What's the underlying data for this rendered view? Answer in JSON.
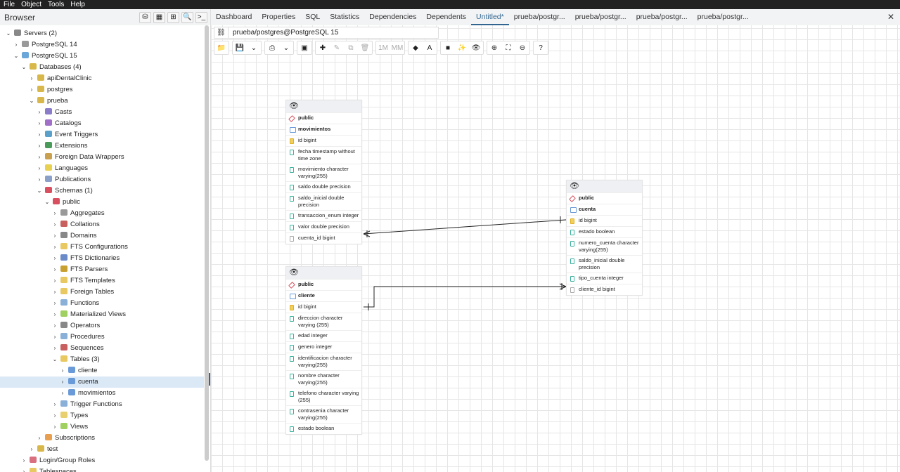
{
  "menu": [
    "File",
    "Object",
    "Tools",
    "Help"
  ],
  "browser": {
    "title": "Browser",
    "tools": [
      "⛁",
      "▦",
      "⊞",
      "🔍",
      ">_"
    ]
  },
  "tree": [
    {
      "label": "Servers (2)",
      "level": 0,
      "open": true,
      "color": "#888"
    },
    {
      "label": "PostgreSQL 14",
      "level": 1,
      "open": false,
      "color": "#999"
    },
    {
      "label": "PostgreSQL 15",
      "level": 1,
      "open": true,
      "color": "#6aa7d8"
    },
    {
      "label": "Databases (4)",
      "level": 2,
      "open": true,
      "color": "#d8b84a"
    },
    {
      "label": "apiDentalClinic",
      "level": 3,
      "open": false,
      "color": "#d8b84a"
    },
    {
      "label": "postgres",
      "level": 3,
      "open": false,
      "color": "#d8b84a"
    },
    {
      "label": "prueba",
      "level": 3,
      "open": true,
      "color": "#d8b84a"
    },
    {
      "label": "Casts",
      "level": 4,
      "open": false,
      "color": "#8a7cc8"
    },
    {
      "label": "Catalogs",
      "level": 4,
      "open": false,
      "color": "#a070c8"
    },
    {
      "label": "Event Triggers",
      "level": 4,
      "open": false,
      "color": "#5aa0c8"
    },
    {
      "label": "Extensions",
      "level": 4,
      "open": false,
      "color": "#4a9a5a"
    },
    {
      "label": "Foreign Data Wrappers",
      "level": 4,
      "open": false,
      "color": "#c8a050"
    },
    {
      "label": "Languages",
      "level": 4,
      "open": false,
      "color": "#e8d050"
    },
    {
      "label": "Publications",
      "level": 4,
      "open": false,
      "color": "#8aa0c8"
    },
    {
      "label": "Schemas (1)",
      "level": 4,
      "open": true,
      "color": "#d85060"
    },
    {
      "label": "public",
      "level": 5,
      "open": true,
      "color": "#d85060"
    },
    {
      "label": "Aggregates",
      "level": 6,
      "open": false,
      "color": "#999"
    },
    {
      "label": "Collations",
      "level": 6,
      "open": false,
      "color": "#c86060"
    },
    {
      "label": "Domains",
      "level": 6,
      "open": false,
      "color": "#888"
    },
    {
      "label": "FTS Configurations",
      "level": 6,
      "open": false,
      "color": "#e8c860"
    },
    {
      "label": "FTS Dictionaries",
      "level": 6,
      "open": false,
      "color": "#6a8ac8"
    },
    {
      "label": "FTS Parsers",
      "level": 6,
      "open": false,
      "color": "#c8a030"
    },
    {
      "label": "FTS Templates",
      "level": 6,
      "open": false,
      "color": "#e8c860"
    },
    {
      "label": "Foreign Tables",
      "level": 6,
      "open": false,
      "color": "#e8c860"
    },
    {
      "label": "Functions",
      "level": 6,
      "open": false,
      "color": "#8ab0d8"
    },
    {
      "label": "Materialized Views",
      "level": 6,
      "open": false,
      "color": "#a0d060"
    },
    {
      "label": "Operators",
      "level": 6,
      "open": false,
      "color": "#888"
    },
    {
      "label": "Procedures",
      "level": 6,
      "open": false,
      "color": "#8ab0d8"
    },
    {
      "label": "Sequences",
      "level": 6,
      "open": false,
      "color": "#c86060"
    },
    {
      "label": "Tables (3)",
      "level": 6,
      "open": true,
      "color": "#e8c860"
    },
    {
      "label": "cliente",
      "level": 7,
      "open": false,
      "color": "#6a9ad8"
    },
    {
      "label": "cuenta",
      "level": 7,
      "open": false,
      "color": "#6a9ad8",
      "selected": true
    },
    {
      "label": "movimientos",
      "level": 7,
      "open": false,
      "color": "#6a9ad8"
    },
    {
      "label": "Trigger Functions",
      "level": 6,
      "open": false,
      "color": "#8ab0d8"
    },
    {
      "label": "Types",
      "level": 6,
      "open": false,
      "color": "#e8d070"
    },
    {
      "label": "Views",
      "level": 6,
      "open": false,
      "color": "#a0d060"
    },
    {
      "label": "Subscriptions",
      "level": 4,
      "open": false,
      "color": "#e8a050"
    },
    {
      "label": "test",
      "level": 3,
      "open": false,
      "color": "#d8b84a"
    },
    {
      "label": "Login/Group Roles",
      "level": 2,
      "open": false,
      "color": "#d87080"
    },
    {
      "label": "Tablespaces",
      "level": 2,
      "open": false,
      "color": "#e8c860"
    }
  ],
  "tabs": [
    "Dashboard",
    "Properties",
    "SQL",
    "Statistics",
    "Dependencies",
    "Dependents",
    "Untitled*",
    "prueba/postgr...",
    "prueba/postgr...",
    "prueba/postgr...",
    "prueba/postgr..."
  ],
  "active_tab": 6,
  "connection": "prueba/postgres@PostgreSQL 15",
  "toolbar": [
    [
      "📁"
    ],
    [
      "💾",
      "⌄"
    ],
    [
      "⎙",
      "⌄"
    ],
    [
      "▣"
    ],
    [
      "✚",
      "✎",
      "⧉",
      "🗑"
    ],
    [
      "1M",
      "MM"
    ],
    [
      "◆",
      "A"
    ],
    [
      "■",
      "✨",
      "👁"
    ],
    [
      "⊕",
      "⛶",
      "⊖"
    ],
    [
      "?"
    ]
  ],
  "erd_tables": [
    {
      "schema": "public",
      "name": "movimientos",
      "columns": [
        "id bigint",
        "fecha timestamp without time zone",
        "movimiento character varying(255)",
        "saldo double precision",
        "saldo_inicial double precision",
        "transaccion_enum integer",
        "valor double precision",
        "cuenta_id bigint"
      ]
    },
    {
      "schema": "public",
      "name": "cuenta",
      "columns": [
        "id bigint",
        "estado boolean",
        "numero_cuenta character varying(255)",
        "saldo_inicial double precision",
        "tipo_cuenta integer",
        "cliente_id bigint"
      ]
    },
    {
      "schema": "public",
      "name": "cliente",
      "columns": [
        "id bigint",
        "direccion character varying (255)",
        "edad integer",
        "genero integer",
        "identificacion character varying(255)",
        "nombre character varying(255)",
        "telefono character varying (255)",
        "contrasenia character varying(255)",
        "estado boolean"
      ]
    }
  ]
}
